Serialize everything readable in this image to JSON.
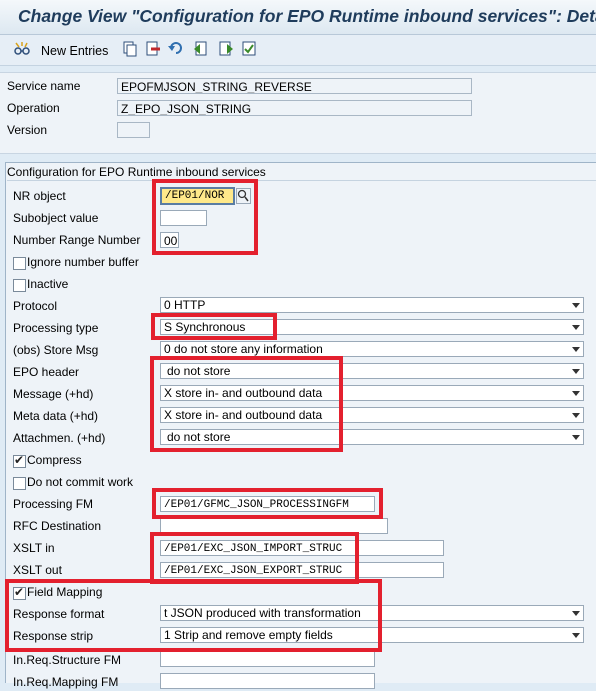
{
  "window": {
    "title": "Change View \"Configuration for EPO Runtime inbound services\": Details"
  },
  "toolbar": {
    "new_entries_label": "New Entries",
    "icons": [
      "glasses-icon",
      "copy-icon",
      "delete-icon",
      "undo-icon",
      "previous-entry-icon",
      "next-entry-icon",
      "select-all-icon"
    ]
  },
  "header": {
    "service_name_label": "Service name",
    "service_name_value": "EPOFMJSON_STRING_REVERSE",
    "operation_label": "Operation",
    "operation_value": "Z_EPO_JSON_STRING",
    "version_label": "Version",
    "version_value": ""
  },
  "config": {
    "group_title": "Configuration for EPO Runtime inbound services",
    "nr_object_label": "NR object",
    "nr_object_value": "/EP01/NOR",
    "subobject_label": "Subobject value",
    "subobject_value": "",
    "nr_number_label": "Number Range Number",
    "nr_number_value": "00",
    "ignore_buffer_label": "Ignore number buffer",
    "ignore_buffer_checked": false,
    "inactive_label": "Inactive",
    "inactive_checked": false,
    "protocol_label": "Protocol",
    "protocol_value": "0 HTTP",
    "processing_type_label": "Processing type",
    "processing_type_value": "S Synchronous",
    "store_msg_label": "(obs) Store Msg",
    "store_msg_value": "0 do not store any information",
    "epo_header_label": "EPO header",
    "epo_header_value": "do not store",
    "message_label": "Message (+hd)",
    "message_value": "X store in- and outbound data",
    "meta_data_label": "Meta data (+hd)",
    "meta_data_value": "X store in- and outbound data",
    "attachmen_label": "Attachmen. (+hd)",
    "attachmen_value": "do not store",
    "compress_label": "Compress",
    "compress_checked": true,
    "no_commit_label": "Do not commit work",
    "no_commit_checked": false,
    "processing_fm_label": "Processing FM",
    "processing_fm_value": "/EP01/GFMC_JSON_PROCESSINGFM",
    "rfc_dest_label": "RFC Destination",
    "rfc_dest_value": "",
    "xslt_in_label": "XSLT in",
    "xslt_in_value": "/EP01/EXC_JSON_IMPORT_STRUC",
    "xslt_out_label": "XSLT out",
    "xslt_out_value": "/EP01/EXC_JSON_EXPORT_STRUC",
    "field_mapping_label": "Field Mapping",
    "field_mapping_checked": true,
    "response_format_label": "Response format",
    "response_format_value": "t JSON produced with transformation",
    "response_strip_label": "Response strip",
    "response_strip_value": "1 Strip and remove empty fields",
    "in_req_structure_label": "In.Req.Structure FM",
    "in_req_structure_value": "",
    "in_req_mapping_label": "In.Req.Mapping FM",
    "in_req_mapping_value": ""
  },
  "colors": {
    "highlight_border": "#e3202e",
    "background": "#dfebf5",
    "title_text": "#1f3c5c"
  }
}
